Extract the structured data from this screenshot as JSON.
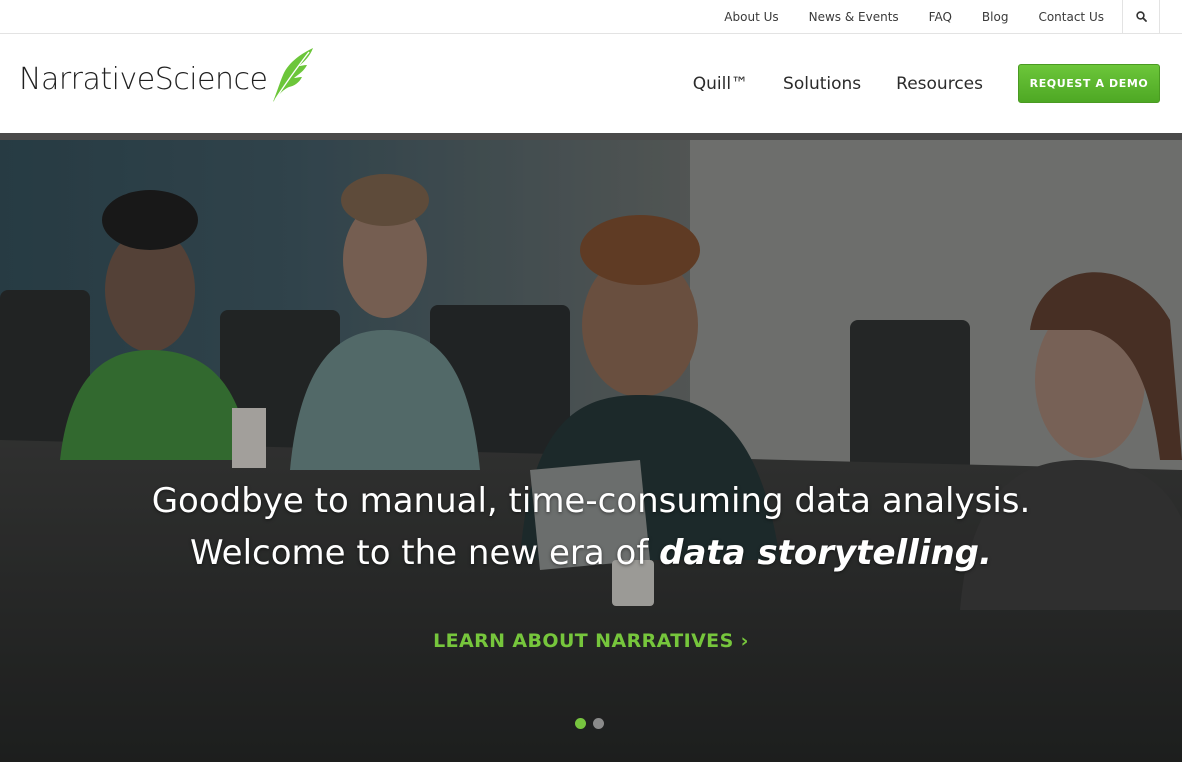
{
  "utility_nav": {
    "links": [
      "About Us",
      "News & Events",
      "FAQ",
      "Blog",
      "Contact Us"
    ],
    "search_icon": "search-icon"
  },
  "brand": {
    "name_part1": "Narrative",
    "name_part2": "Science",
    "logo_icon": "quill-icon",
    "accent_color": "#6cc63a"
  },
  "primary_nav": {
    "items": [
      "Quill™",
      "Solutions",
      "Resources"
    ],
    "cta_label": "REQUEST A DEMO"
  },
  "hero": {
    "headline_line1": "Goodbye to manual, time-consuming data analysis.",
    "headline_line2_prefix": "Welcome to the new era of ",
    "headline_line2_emphasis": "data storytelling",
    "headline_line2_suffix": ".",
    "cta_label": "LEARN ABOUT NARRATIVES ›",
    "slides": {
      "count": 2,
      "active_index": 0
    }
  }
}
